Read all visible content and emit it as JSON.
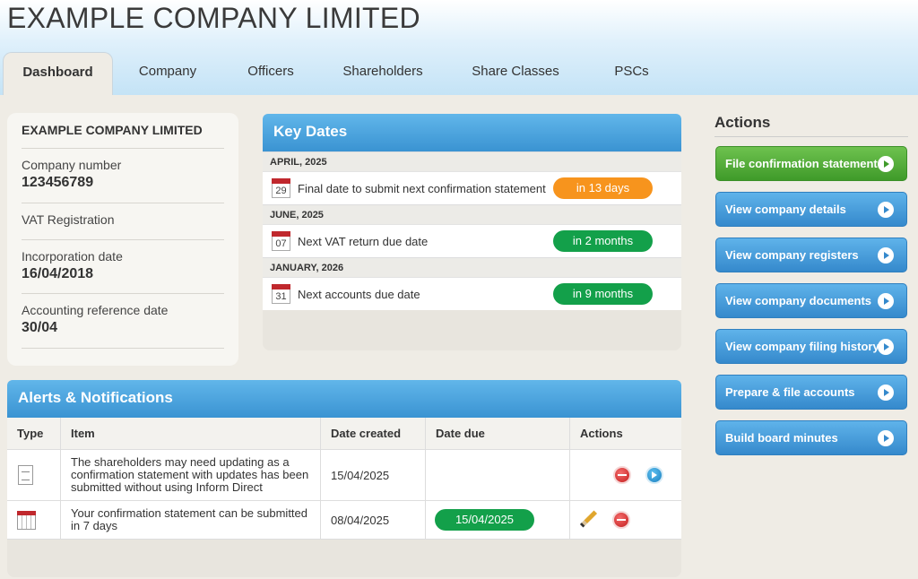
{
  "app": {
    "title": "EXAMPLE COMPANY LIMITED"
  },
  "tabs": [
    "Dashboard",
    "Company",
    "Officers",
    "Shareholders",
    "Share Classes",
    "PSCs"
  ],
  "company_info": {
    "name": "EXAMPLE COMPANY LIMITED",
    "fields": [
      {
        "label": "Company number",
        "value": "123456789"
      },
      {
        "label": "VAT Registration",
        "value": ""
      },
      {
        "label": "Incorporation date",
        "value": "16/04/2018"
      },
      {
        "label": "Accounting reference date",
        "value": "30/04"
      }
    ]
  },
  "key_dates": {
    "title": "Key Dates",
    "groups": [
      {
        "month": "APRIL, 2025",
        "day": "29",
        "text": "Final date to submit next confirmation statement",
        "badge": "in 13 days",
        "badge_color": "#f7941d"
      },
      {
        "month": "JUNE, 2025",
        "day": "07",
        "text": "Next VAT return due date",
        "badge": "in 2 months",
        "badge_color": "#13a04a"
      },
      {
        "month": "JANUARY, 2026",
        "day": "31",
        "text": "Next accounts due date",
        "badge": "in 9 months",
        "badge_color": "#13a04a"
      }
    ]
  },
  "actions": {
    "title": "Actions",
    "buttons": [
      "File confirmation statement",
      "View company details",
      "View company registers",
      "View company documents",
      "View company filing history",
      "Prepare & file accounts",
      "Build board minutes"
    ]
  },
  "alerts": {
    "title": "Alerts & Notifications",
    "columns": [
      "Type",
      "Item",
      "Date created",
      "Date due",
      "Actions"
    ],
    "rows": [
      {
        "type_icon": "document-icon",
        "item": "The shareholders may need updating as a confirmation statement with updates has been submitted without using Inform Direct",
        "date_created": "15/04/2025",
        "date_due": ""
      },
      {
        "type_icon": "calendar-icon",
        "item": "Your confirmation statement can be submitted in 7 days",
        "date_created": "08/04/2025",
        "date_due": "15/04/2025"
      }
    ]
  },
  "colors": {
    "accent_blue": "#3a93d2",
    "status_green": "#13a04a",
    "status_orange": "#f7941d",
    "alert_red": "#c41e1e"
  }
}
